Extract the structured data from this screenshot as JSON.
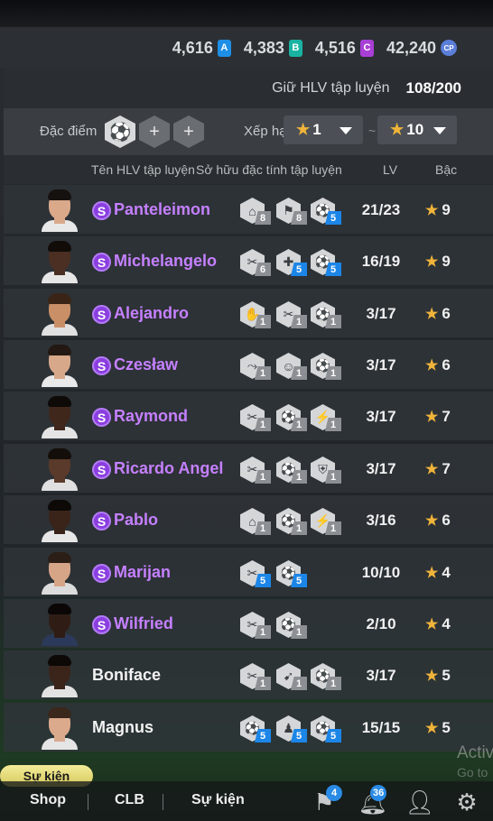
{
  "currency": [
    {
      "value": "4,616",
      "icon": "a-coin-icon",
      "letter": "A",
      "color": "#1e8fe6"
    },
    {
      "value": "4,383",
      "icon": "b-coin-icon",
      "letter": "B",
      "color": "#19b3a3"
    },
    {
      "value": "4,516",
      "icon": "c-coin-icon",
      "letter": "C",
      "color": "#a93fd6"
    },
    {
      "value": "42,240",
      "icon": "cp-coin-icon",
      "letter": "CP",
      "color": "#5b7ed9"
    }
  ],
  "hold": {
    "label": "Giữ HLV tập luyện",
    "count": "108/200"
  },
  "filter": {
    "trait_label": "Đặc điểm c",
    "rank_label": "Xếp hạ",
    "grade_from": "1",
    "grade_to": "10",
    "tilde": "~"
  },
  "columns": {
    "name": "Tên HLV tập luyện",
    "traits": "Sở hữu đặc tính tập luyện",
    "lv": "LV",
    "grade": "Bậc"
  },
  "coaches": [
    {
      "name": "Panteleimon",
      "special": true,
      "skin": "#d9a98a",
      "shirt": "#e8e8e8",
      "hair": "#15110e",
      "traits": [
        {
          "icon": "goal-icon",
          "glyph": "⌂",
          "level": "8",
          "tone": "gray"
        },
        {
          "icon": "skill-icon",
          "glyph": "⚑",
          "level": "8",
          "tone": "gray"
        },
        {
          "icon": "ball-control-icon",
          "glyph": "⚽",
          "level": "5",
          "tone": "blue"
        }
      ],
      "lv": "21/23",
      "grade": "9"
    },
    {
      "name": "Michelangelo",
      "special": true,
      "skin": "#4a2f22",
      "shirt": "#e6e6e6",
      "hair": "#120c09",
      "traits": [
        {
          "icon": "tackle-icon",
          "glyph": "✂",
          "level": "6",
          "tone": "gray"
        },
        {
          "icon": "fitness-icon",
          "glyph": "✚",
          "level": "5",
          "tone": "blue"
        },
        {
          "icon": "ball-control-icon",
          "glyph": "⚽",
          "level": "5",
          "tone": "blue"
        }
      ],
      "lv": "16/19",
      "grade": "9"
    },
    {
      "name": "Alejandro",
      "special": true,
      "skin": "#c98f66",
      "shirt": "#e1e1e1",
      "hair": "#3a2416",
      "traits": [
        {
          "icon": "goalkeeper-icon",
          "glyph": "✋",
          "level": "1",
          "tone": "gray"
        },
        {
          "icon": "tackle-icon",
          "glyph": "✂",
          "level": "1",
          "tone": "gray"
        },
        {
          "icon": "ball-control-icon",
          "glyph": "⚽",
          "level": "1",
          "tone": "gray"
        }
      ],
      "lv": "3/17",
      "grade": "6"
    },
    {
      "name": "Czesław",
      "special": true,
      "skin": "#d7a88a",
      "shirt": "#e9e9e9",
      "hair": "#231813",
      "traits": [
        {
          "icon": "dribble-icon",
          "glyph": "⤳",
          "level": "1",
          "tone": "gray"
        },
        {
          "icon": "header-icon",
          "glyph": "☺",
          "level": "1",
          "tone": "gray"
        },
        {
          "icon": "ball-control-icon",
          "glyph": "⚽",
          "level": "1",
          "tone": "gray"
        }
      ],
      "lv": "3/17",
      "grade": "6"
    },
    {
      "name": "Raymond",
      "special": true,
      "skin": "#3f271c",
      "shirt": "#e4e4e4",
      "hair": "#0e0a08",
      "traits": [
        {
          "icon": "tackle-icon",
          "glyph": "✂",
          "level": "1",
          "tone": "gray"
        },
        {
          "icon": "ball-control-icon",
          "glyph": "⚽",
          "level": "1",
          "tone": "gray"
        },
        {
          "icon": "sprint-icon",
          "glyph": "⚡",
          "level": "1",
          "tone": "gray"
        }
      ],
      "lv": "3/17",
      "grade": "7"
    },
    {
      "name": "Ricardo Angel",
      "special": true,
      "skin": "#5a3a2a",
      "shirt": "#e0e0e0",
      "hair": "#140e0a",
      "traits": [
        {
          "icon": "tackle-icon",
          "glyph": "✂",
          "level": "1",
          "tone": "gray"
        },
        {
          "icon": "ball-control-icon",
          "glyph": "⚽",
          "level": "1",
          "tone": "gray"
        },
        {
          "icon": "defense-icon",
          "glyph": "⛨",
          "level": "1",
          "tone": "gray"
        }
      ],
      "lv": "3/17",
      "grade": "7"
    },
    {
      "name": "Pablo",
      "special": true,
      "skin": "#3a241a",
      "shirt": "#e7e7e7",
      "hair": "#0c0907",
      "traits": [
        {
          "icon": "goal-icon",
          "glyph": "⌂",
          "level": "1",
          "tone": "gray"
        },
        {
          "icon": "ball-control-icon",
          "glyph": "⚽",
          "level": "1",
          "tone": "gray"
        },
        {
          "icon": "sprint-icon",
          "glyph": "⚡",
          "level": "1",
          "tone": "gray"
        }
      ],
      "lv": "3/16",
      "grade": "6"
    },
    {
      "name": "Marijan",
      "special": true,
      "skin": "#d6a487",
      "shirt": "#dcdcdc",
      "hair": "#2b1e17",
      "traits": [
        {
          "icon": "tackle-icon",
          "glyph": "✂",
          "level": "5",
          "tone": "blue"
        },
        {
          "icon": "ball-control-icon",
          "glyph": "⚽",
          "level": "5",
          "tone": "blue"
        }
      ],
      "lv": "10/10",
      "grade": "4"
    },
    {
      "name": "Wilfried",
      "special": true,
      "skin": "#2f1d15",
      "shirt": "#2b3a5a",
      "hair": "#0a0706",
      "traits": [
        {
          "icon": "tackle-icon",
          "glyph": "✂",
          "level": "1",
          "tone": "gray"
        },
        {
          "icon": "ball-control-icon",
          "glyph": "⚽",
          "level": "1",
          "tone": "gray"
        }
      ],
      "lv": "2/10",
      "grade": "4"
    },
    {
      "name": "Boniface",
      "special": false,
      "skin": "#3b251b",
      "shirt": "#e2e2e2",
      "hair": "#0c0907",
      "traits": [
        {
          "icon": "tackle-icon",
          "glyph": "✂",
          "level": "1",
          "tone": "gray"
        },
        {
          "icon": "shooting-icon",
          "glyph": "➹",
          "level": "1",
          "tone": "gray"
        },
        {
          "icon": "ball-control-icon",
          "glyph": "⚽",
          "level": "1",
          "tone": "gray"
        }
      ],
      "lv": "3/17",
      "grade": "5"
    },
    {
      "name": "Magnus",
      "special": false,
      "skin": "#dba98c",
      "shirt": "#e5e5e5",
      "hair": "#3a281c",
      "traits": [
        {
          "icon": "ball-icon",
          "glyph": "⚽",
          "level": "5",
          "tone": "blue"
        },
        {
          "icon": "coach-icon",
          "glyph": "♟",
          "level": "5",
          "tone": "blue"
        },
        {
          "icon": "ball-control-icon",
          "glyph": "⚽",
          "level": "5",
          "tone": "blue"
        }
      ],
      "lv": "15/15",
      "grade": "5"
    }
  ],
  "event_label": "Sự kiện",
  "nav": {
    "shop": "Shop",
    "clb": "CLB",
    "events": "Sự kiện",
    "badge_inbox": "4",
    "badge_notif": "36"
  },
  "watermark": {
    "line1": "Activ",
    "line2": "Go to"
  },
  "colors": {
    "accent_purple": "#c580ff",
    "star": "#f0b43a",
    "badge_blue": "#2a8be6"
  }
}
